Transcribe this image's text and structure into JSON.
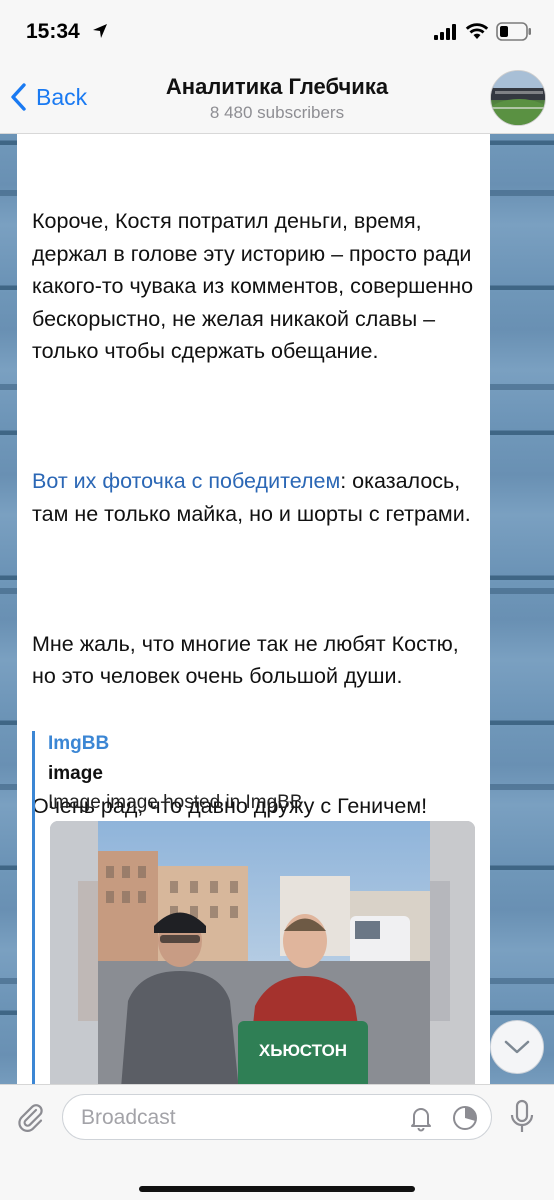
{
  "status_bar": {
    "time": "15:34"
  },
  "header": {
    "back_label": "Back",
    "title": "Аналитика Глебчика",
    "subtitle": "8 480 subscribers"
  },
  "message": {
    "paragraphs": [
      "Короче, Костя потратил деньги, время, держал в голове эту историю – просто ради какого-то чувака из комментов, совершенно бескорыстно, не желая никакой славы – только чтобы сдержать обещание.",
      "",
      "Мне жаль, что многие так не любят Костю, но это человек очень большой души.",
      "Очень рад, что давно дружу с Геничем!"
    ],
    "link_text": "Вот их фоточка с победителем",
    "link_tail": ": оказалось, там не только майка, но и шорты с гетрами."
  },
  "link_preview": {
    "site": "ImgBB",
    "title": "image",
    "description": "Image image hosted in ImgBB",
    "jersey_text": "ХЬЮСТОН"
  },
  "input": {
    "placeholder": "Broadcast",
    "value": ""
  },
  "icons": {
    "back": "chevron-left-icon",
    "attach": "paperclip-icon",
    "bell": "bell-icon",
    "timer": "timer-icon",
    "mic": "microphone-icon",
    "scroll": "chevron-down-icon"
  },
  "colors": {
    "accent": "#1a7af2",
    "link": "#2b67b5",
    "preview_bar": "#3b86d4"
  }
}
